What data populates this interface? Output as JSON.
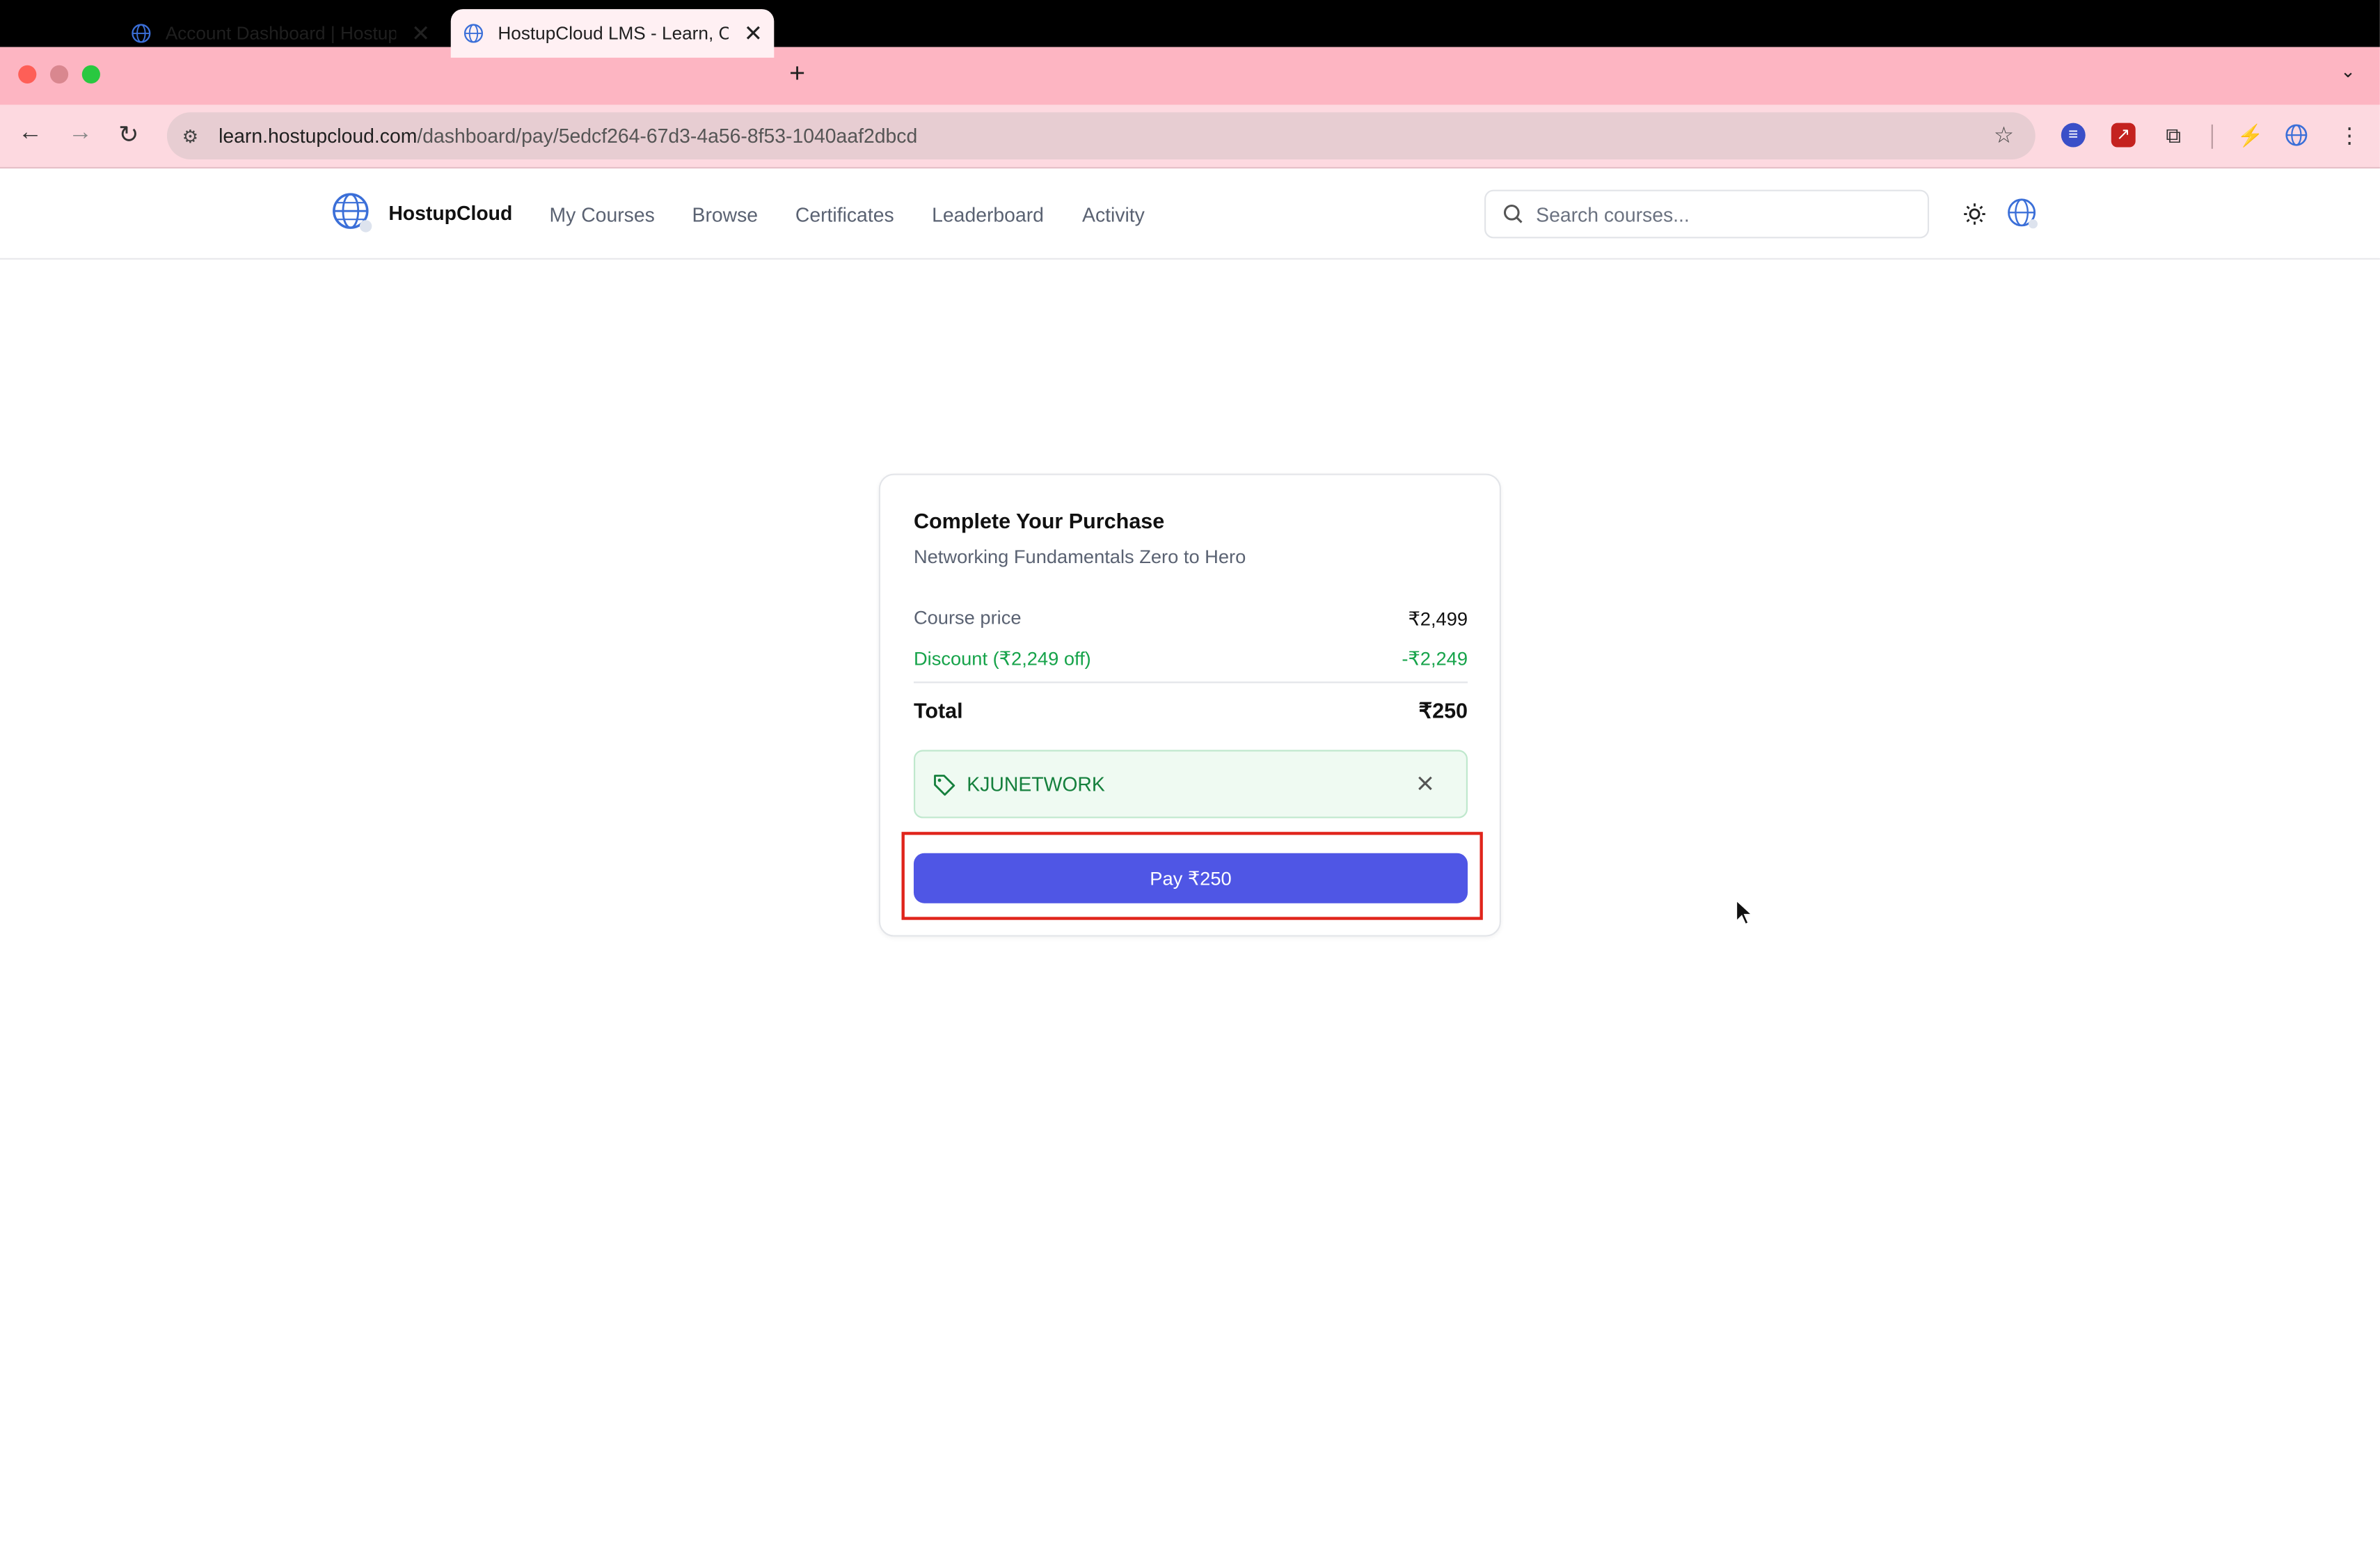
{
  "browser": {
    "tabs": [
      {
        "title": "Account Dashboard | HostupCloud"
      },
      {
        "title": "HostupCloud LMS - Learn, Certify"
      }
    ],
    "url_host": "learn.hostupcloud.com",
    "url_path": "/dashboard/pay/5edcf264-67d3-4a56-8f53-1040aaf2dbcd"
  },
  "nav": {
    "brand": "HostupCloud",
    "links": [
      "My Courses",
      "Browse",
      "Certificates",
      "Leaderboard",
      "Activity"
    ],
    "search_placeholder": "Search courses..."
  },
  "purchase": {
    "title": "Complete Your Purchase",
    "course_name": "Networking Fundamentals Zero to Hero",
    "price_label": "Course price",
    "price_value": "₹2,499",
    "discount_label": "Discount (₹2,249 off)",
    "discount_value": "-₹2,249",
    "total_label": "Total",
    "total_value": "₹250",
    "coupon_code": "KJUNETWORK",
    "pay_label": "Pay ₹250"
  },
  "colors": {
    "accent": "#4f56e5",
    "discount": "#16a34a",
    "highlight": "#e0241b",
    "tabstrip": "#fdb5c2"
  }
}
